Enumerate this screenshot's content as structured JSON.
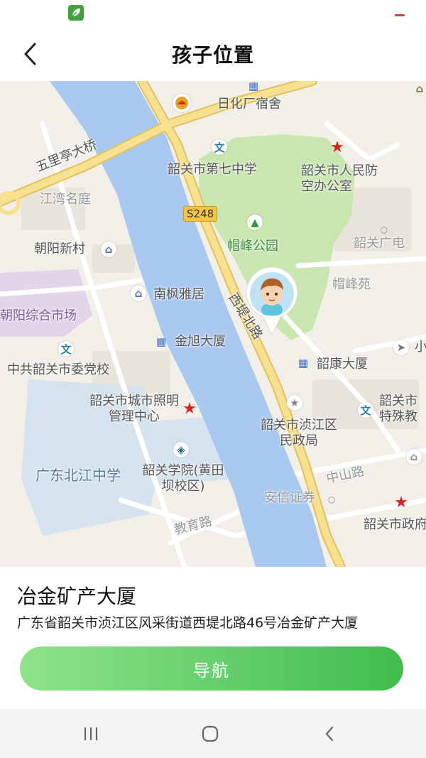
{
  "status_bar": {
    "app_icon": "app-leaf-icon",
    "indicator": "minus-icon"
  },
  "header": {
    "title": "孩子位置",
    "back_icon": "chevron-left-icon"
  },
  "map": {
    "road_badge": "S248",
    "labels": {
      "rihua": "日化厂宿舍",
      "wuli": "五里亭大桥",
      "no7": "韶关市第七中学",
      "renfang": "韶关市人民防空办公室",
      "jiangwan": "江湾名庭",
      "chaoyang": "朝阳新村",
      "maofeng_park": "帽峰公园",
      "guangdian": "韶关广电",
      "nanfeng": "南枫雅居",
      "maofengyuan": "帽峰苑",
      "market": "朝阳综合市场",
      "xidi": "西堤北路",
      "jinxu": "金旭大厦",
      "party": "中共韶关市委党校",
      "kangda": "韶康大厦",
      "lighting": "韶关市城市照明管理中心",
      "minzheng": "韶关市浈江区民政局",
      "special": "韶关市特殊教",
      "beijiang": "广东北江中学",
      "college": "韶关学院(黄田坝校区)",
      "zhongshan": "中山路",
      "anxin": "安信证券",
      "zhengfu": "韶关市政府",
      "jiaoyu": "教育路",
      "xiao": "小"
    }
  },
  "location": {
    "name": "冶金矿产大厦",
    "address": "广东省韶关市浈江区风采街道西堤北路46号冶金矿产大厦"
  },
  "actions": {
    "navigate_label": "导航"
  },
  "system_nav": {
    "recents_icon": "recents-icon",
    "home_icon": "home-circle-icon",
    "back_icon": "back-arrow-icon"
  },
  "colors": {
    "river": "#a9c8f0",
    "park": "#c9e6b0",
    "major_road": "#f7e08f",
    "accent_green": "#3fbd4e",
    "star_red": "#e02020"
  }
}
